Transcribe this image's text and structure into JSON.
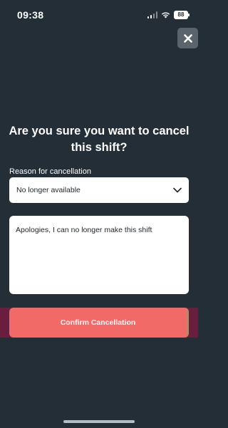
{
  "status_bar": {
    "time": "09:38",
    "battery": "88",
    "icons": [
      "signal-icon",
      "wifi-icon",
      "battery-icon"
    ]
  },
  "dialog": {
    "close_icon": "close-icon",
    "title": "Are you sure you want to cancel this shift?",
    "reason_label": "Reason for cancellation",
    "reason_selected": "No longer available",
    "reason_chevron_icon": "chevron-down-icon",
    "message": "Apologies, I can no longer make this shift",
    "confirm_label": "Confirm Cancellation"
  },
  "colors": {
    "background": "#232e36",
    "confirm": "#f26a68",
    "close_button": "#5b646b"
  }
}
